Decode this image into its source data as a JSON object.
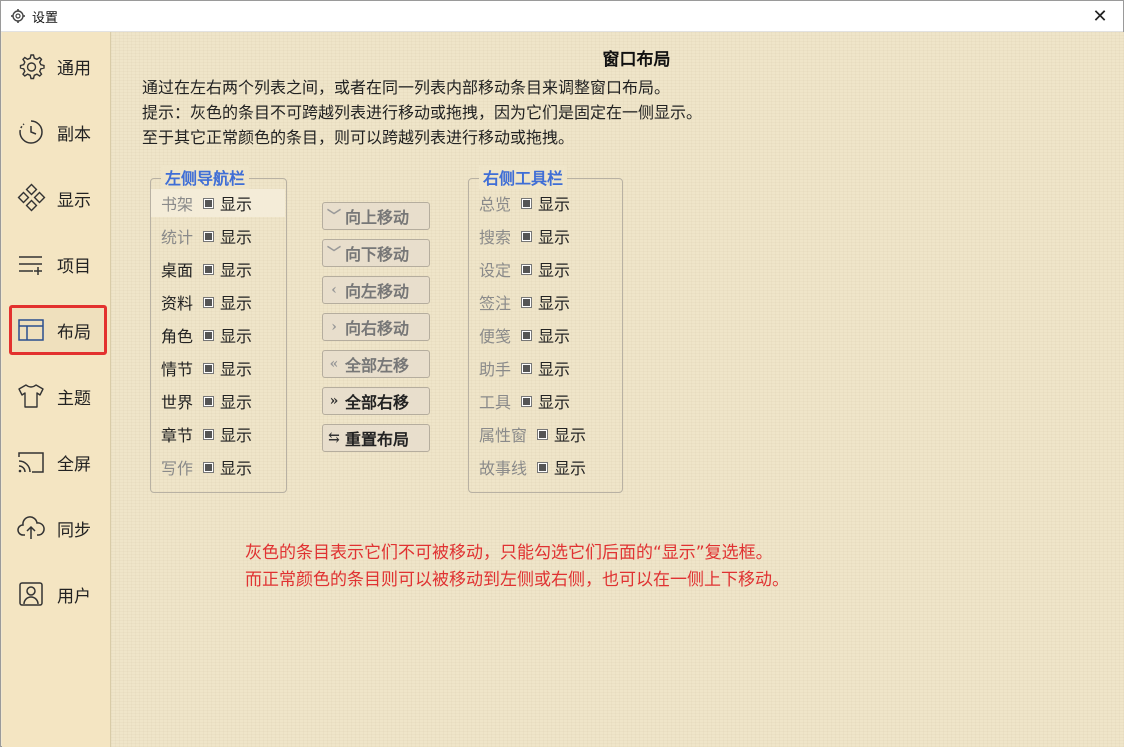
{
  "window": {
    "title": "设置",
    "close_icon": "close-icon"
  },
  "sidebar": {
    "items": [
      {
        "label": "通用",
        "icon": "gear-icon"
      },
      {
        "label": "副本",
        "icon": "clock-icon"
      },
      {
        "label": "显示",
        "icon": "display-icon"
      },
      {
        "label": "项目",
        "icon": "list-add-icon"
      },
      {
        "label": "布局",
        "icon": "layout-icon",
        "active": true
      },
      {
        "label": "主题",
        "icon": "shirt-icon"
      },
      {
        "label": "全屏",
        "icon": "cast-icon"
      },
      {
        "label": "同步",
        "icon": "cloud-upload-icon"
      },
      {
        "label": "用户",
        "icon": "user-icon"
      }
    ],
    "active_color": "#e3312e"
  },
  "main": {
    "heading": "窗口布局",
    "desc": [
      "通过在左右两个列表之间，或者在同一列表内部移动条目来调整窗口布局。",
      "提示：灰色的条目不可跨越列表进行移动或拖拽，因为它们是固定在一侧显示。",
      "至于其它正常颜色的条目，则可以跨越列表进行移动或拖拽。"
    ],
    "left_group": {
      "title": "左侧导航栏",
      "items": [
        {
          "name": "书架",
          "gray": true,
          "show": "显示"
        },
        {
          "name": "统计",
          "gray": true,
          "show": "显示"
        },
        {
          "name": "桌面",
          "gray": false,
          "show": "显示"
        },
        {
          "name": "资料",
          "gray": false,
          "show": "显示"
        },
        {
          "name": "角色",
          "gray": false,
          "show": "显示"
        },
        {
          "name": "情节",
          "gray": false,
          "show": "显示"
        },
        {
          "name": "世界",
          "gray": false,
          "show": "显示"
        },
        {
          "name": "章节",
          "gray": false,
          "show": "显示"
        },
        {
          "name": "写作",
          "gray": true,
          "show": "显示"
        }
      ]
    },
    "right_group": {
      "title": "右侧工具栏",
      "items": [
        {
          "name": "总览",
          "gray": true,
          "show": "显示"
        },
        {
          "name": "搜索",
          "gray": true,
          "show": "显示"
        },
        {
          "name": "设定",
          "gray": true,
          "show": "显示"
        },
        {
          "name": "签注",
          "gray": true,
          "show": "显示"
        },
        {
          "name": "便笺",
          "gray": true,
          "show": "显示"
        },
        {
          "name": "助手",
          "gray": true,
          "show": "显示"
        },
        {
          "name": "工具",
          "gray": true,
          "show": "显示"
        },
        {
          "name": "属性窗",
          "gray": true,
          "show": "显示"
        },
        {
          "name": "故事线",
          "gray": true,
          "show": "显示"
        }
      ]
    },
    "buttons": [
      {
        "label": "向上移动",
        "icon": "﹀",
        "enabled": false
      },
      {
        "label": "向下移动",
        "icon": "﹀",
        "enabled": false
      },
      {
        "label": "向左移动",
        "icon": "‹",
        "enabled": false
      },
      {
        "label": "向右移动",
        "icon": "›",
        "enabled": false
      },
      {
        "label": "全部左移",
        "icon": "«",
        "enabled": false
      },
      {
        "label": "全部右移",
        "icon": "»",
        "enabled": true
      },
      {
        "label": "重置布局",
        "icon": "⇆",
        "enabled": true
      }
    ],
    "notes": [
      "灰色的条目表示它们不可被移动，只能勾选它们后面的“显示”复选框。",
      "而正常颜色的条目则可以被移动到左侧或右侧，也可以在一侧上下移动。"
    ],
    "note_color": "#e03232",
    "accent_color": "#3f6ed6"
  }
}
